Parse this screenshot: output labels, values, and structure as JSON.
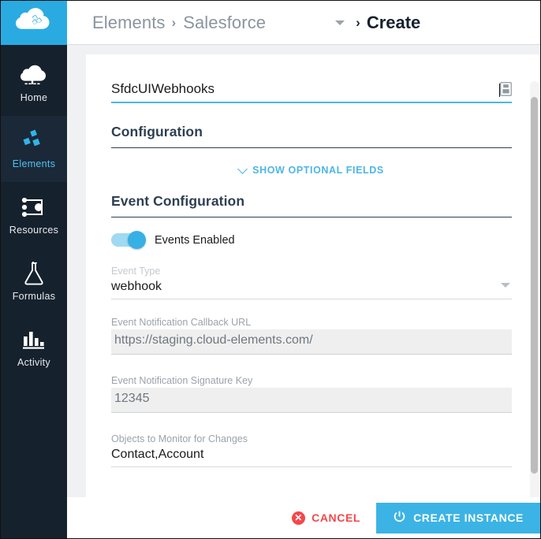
{
  "app": {
    "logo_icon": "cloud-elements-logo-icon",
    "accent": "#29abe2",
    "sidebar_bg": "#16212e",
    "link_blue": "#4cb6e5",
    "danger_red": "#f4484b"
  },
  "breadcrumb": {
    "root": "Elements",
    "sep1": "›",
    "element": "Salesforce",
    "caret_icon": "chevron-down-icon",
    "sep2": "›",
    "current": "Create"
  },
  "sidebar": {
    "items": [
      {
        "label": "Home",
        "icon": "cloud-home-icon",
        "active": false
      },
      {
        "label": "Elements",
        "icon": "elements-blocks-icon",
        "active": true
      },
      {
        "label": "Resources",
        "icon": "resources-nodes-icon",
        "active": false
      },
      {
        "label": "Formulas",
        "icon": "flask-icon",
        "active": false
      },
      {
        "label": "Activity",
        "icon": "bar-chart-icon",
        "active": false
      }
    ]
  },
  "form": {
    "name": {
      "value": "SfdcUIWebhooks",
      "placeholder": "Instance Name",
      "trailing_icon": "save-document-icon"
    },
    "configuration_heading": "Configuration",
    "optional_fields_link": {
      "label": "SHOW OPTIONAL FIELDS",
      "icon": "chevron-down-icon"
    },
    "event_configuration_heading": "Event Configuration",
    "events_toggle": {
      "label": "Events Enabled",
      "state": "on"
    },
    "fields": [
      {
        "label": "Event Type",
        "value": "webhook",
        "style": "select",
        "label_muted": true,
        "caret_icon": "chevron-down-icon"
      },
      {
        "label": "Event Notification Callback URL",
        "value": "https://staging.cloud-elements.com/",
        "style": "filled",
        "label_muted": false
      },
      {
        "label": "Event Notification Signature Key",
        "value": "12345",
        "style": "filled",
        "label_muted": false
      },
      {
        "label": "Objects to Monitor for Changes",
        "value": "Contact,Account",
        "style": "plain",
        "label_muted": false
      }
    ]
  },
  "footer": {
    "cancel": {
      "label": "CANCEL",
      "icon": "close-circle-icon"
    },
    "create": {
      "label": "CREATE INSTANCE",
      "icon": "power-icon"
    }
  }
}
